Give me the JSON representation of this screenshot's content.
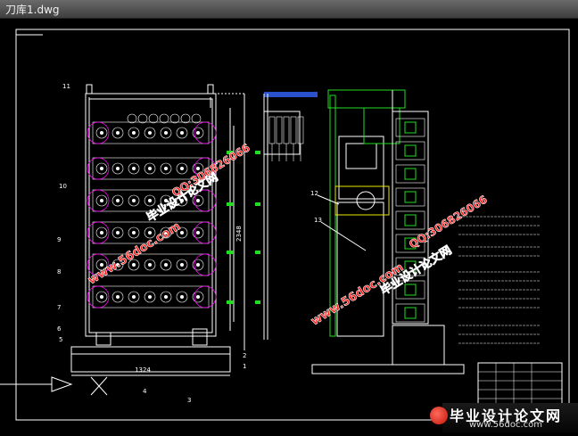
{
  "window": {
    "title": "刀库1.dwg"
  },
  "drawing": {
    "left_view": {
      "part_numbers": [
        "11",
        "10",
        "9",
        "8",
        "7",
        "6",
        "5",
        "4",
        "3",
        "2",
        "1"
      ],
      "width_dim": "1324",
      "height_dim": "2348"
    },
    "right_view": {
      "part_numbers": [
        "12",
        "13"
      ]
    },
    "notes_block_1": "1.刀库采用链式结构...",
    "notes_block_2": "2.刀具在刀库中的位置...",
    "notes_block_3": "3.装配前检查..."
  },
  "watermarks": {
    "site_cn": "毕业设计论文网",
    "site_url": "www.56doc.com",
    "qq": "QQ:306826066"
  },
  "footer_brand": {
    "cn": "毕业设计论文网",
    "url": "www.56doc.com"
  },
  "colors": {
    "background": "#000000",
    "line_white": "#ffffff",
    "line_green": "#22dd22",
    "line_yellow": "#e8e800",
    "line_magenta": "#ff00ff",
    "watermark_red": "#ff1a1a"
  }
}
